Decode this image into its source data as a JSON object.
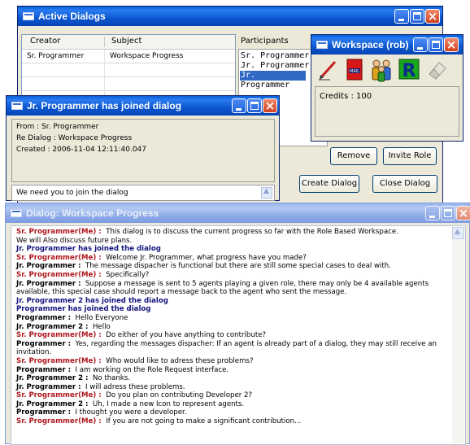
{
  "active_dialogs": {
    "title": "Active Dialogs",
    "columns": {
      "creator": "Creator",
      "subject": "Subject",
      "participants": "Participants"
    },
    "rows": [
      {
        "creator": "Sr. Programmer",
        "subject": "Workspace Progress"
      }
    ],
    "participants": [
      "Sr. Programmer",
      "Jr. Programmer",
      "Jr. Programmer 2",
      "Programmer"
    ],
    "selected_participant_index": 2,
    "buttons": {
      "remove": "Remove",
      "invite_role": "Invite Role",
      "create_dialog": "Create Dialog",
      "close_dialog": "Close Dialog"
    }
  },
  "workspace": {
    "title": "Workspace (rob)",
    "icons": [
      "pencil-icon",
      "mail-icon",
      "people-icon",
      "role-r-icon",
      "eraser-icon"
    ],
    "credits": "Credits : 100"
  },
  "notification": {
    "title": "Jr. Programmer has joined dialog",
    "from": "From : Sr. Programmer",
    "re": "Re Dialog : Workspace Progress",
    "created": "Created : 2006-11-04 12:11:40.047",
    "message": "We need you to join the dialog"
  },
  "dialog": {
    "title": "Dialog: Workspace Progress",
    "messages": [
      {
        "speaker": "Sr. Programmer(Me) :",
        "text": "This dialog is to discuss the current progress so far with the Role Based Workspace.",
        "kind": "me"
      },
      {
        "speaker": "",
        "text": "We will Also discuss future plans.",
        "kind": "cont"
      },
      {
        "speaker": "",
        "text": "Jr. Programmer has joined the dialog",
        "kind": "join"
      },
      {
        "speaker": "Sr. Programmer(Me) :",
        "text": "Welcome Jr. Programmer, what progress have you made?",
        "kind": "me"
      },
      {
        "speaker": "Jr. Programmer :",
        "text": "The message dispacher is functional but there are still some special cases to deal with.",
        "kind": "other"
      },
      {
        "speaker": "Sr. Programmer(Me) :",
        "text": "Specifically?",
        "kind": "me"
      },
      {
        "speaker": "Jr. Programmer :",
        "text": "Suppose a message is sent to 5 agents playing a given role, there may only be 4 available agents",
        "kind": "other"
      },
      {
        "speaker": "",
        "text": "available, this special case should report a message back to the agent who sent the message.",
        "kind": "cont"
      },
      {
        "speaker": "",
        "text": "Jr. Programmer 2 has joined the dialog",
        "kind": "join"
      },
      {
        "speaker": "",
        "text": "Programmer has joined the dialog",
        "kind": "join"
      },
      {
        "speaker": "Programmer :",
        "text": "Hello Everyone",
        "kind": "other"
      },
      {
        "speaker": "Jr. Programmer 2 :",
        "text": "Hello",
        "kind": "other"
      },
      {
        "speaker": "Sr. Programmer(Me) :",
        "text": "Do either of you have anything to contribute?",
        "kind": "me"
      },
      {
        "speaker": "Programmer :",
        "text": "Yes, regarding the messages dispacher: If an agent is already part of a dialog, they may still receive an",
        "kind": "other"
      },
      {
        "speaker": "",
        "text": "invitation.",
        "kind": "cont"
      },
      {
        "speaker": "Sr. Programmer(Me) :",
        "text": "Who would like to adress these problems?",
        "kind": "me"
      },
      {
        "speaker": "Programmer :",
        "text": "I am working on the Role Request interface.",
        "kind": "other"
      },
      {
        "speaker": "Jr. Programmer 2 :",
        "text": "No thanks.",
        "kind": "other"
      },
      {
        "speaker": "Jr. Programmer :",
        "text": "I will adress these problems.",
        "kind": "other"
      },
      {
        "speaker": "Sr. Programmer(Me) :",
        "text": "Do you plan on contributing Developer 2?",
        "kind": "me"
      },
      {
        "speaker": "Jr. Programmer 2 :",
        "text": "Uh, I made a new Icon to represent agents.",
        "kind": "other"
      },
      {
        "speaker": "Programmer :",
        "text": "I thought you were a developer.",
        "kind": "other"
      },
      {
        "speaker": "Sr. Programmer(Me) :",
        "text": "If you are not going to make a significant contribution...",
        "kind": "me"
      }
    ]
  }
}
